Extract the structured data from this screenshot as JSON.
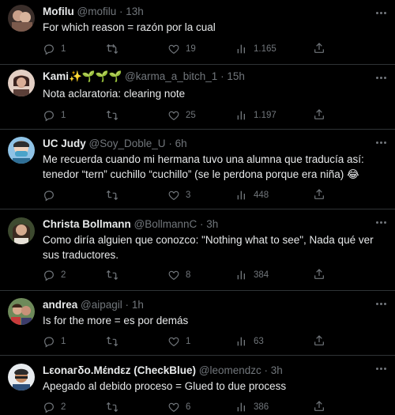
{
  "tweets": [
    {
      "name": "Mofilu",
      "handle": "@mofilu",
      "dot": "·",
      "time": "13h",
      "text": "For which reason = razón por la cual",
      "replies": "1",
      "retweets": "",
      "likes": "19",
      "views": "1.165",
      "avatar_color": "#8a6b5c"
    },
    {
      "name": "Kami✨🌱🌱🌱",
      "handle": "@karma_a_bitch_1",
      "dot": "·",
      "time": "15h",
      "text": "Nota aclaratoria:  clearing note",
      "replies": "1",
      "retweets": "",
      "likes": "25",
      "views": "1.197",
      "avatar_color": "#b07a6e"
    },
    {
      "name": "UC Judy",
      "handle": "@Soy_Doble_U",
      "dot": "·",
      "time": "6h",
      "text": "Me recuerda cuando mi hermana tuvo una alumna que traducía así: tenedor “tern” cuchillo “cuchillo” (se le perdona porque era niña) 😂",
      "replies": "",
      "retweets": "",
      "likes": "3",
      "views": "448",
      "avatar_color": "#5c8fb5"
    },
    {
      "name": "Christa Bollmann",
      "handle": "@BollmannC",
      "dot": "·",
      "time": "3h",
      "text": "Como diría alguien que conozco: \"Nothing what to see\",  Nada qué ver sus traductores.",
      "replies": "2",
      "retweets": "",
      "likes": "8",
      "views": "384",
      "avatar_color": "#6b5a4a"
    },
    {
      "name": "andrea",
      "handle": "@aipagil",
      "dot": "·",
      "time": "1h",
      "text": "Is for the more = es por demás",
      "replies": "1",
      "retweets": "",
      "likes": "1",
      "views": "63",
      "avatar_color": "#9c5a52"
    },
    {
      "name": "Lεοnaгδο.Μέndεz (CheckBlue)",
      "handle": "@leomendzc",
      "dot": "·",
      "time": "3h",
      "text": "Apegado al debido proceso = Glued to due process",
      "replies": "2",
      "retweets": "",
      "likes": "6",
      "views": "386",
      "avatar_color": "#c48a5a"
    }
  ],
  "icons": {
    "reply": "reply-icon",
    "retweet": "retweet-icon",
    "like": "heart-icon",
    "views": "views-icon",
    "share": "share-icon",
    "more": "more-icon"
  },
  "colors": {
    "background": "#000000",
    "text": "#e7e9ea",
    "secondary": "#71767b",
    "divider": "#2f3336"
  }
}
